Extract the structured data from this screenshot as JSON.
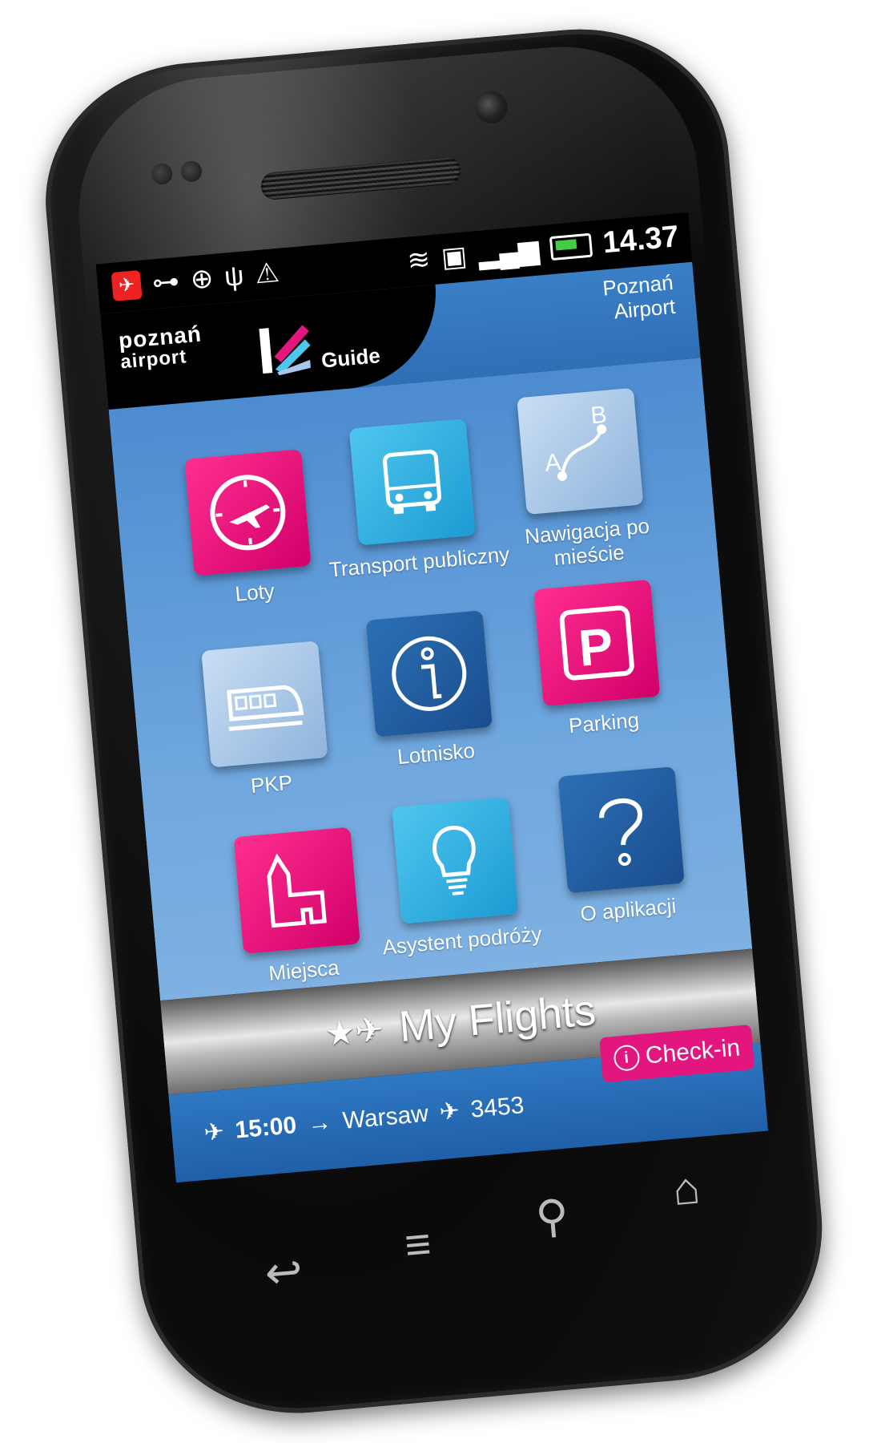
{
  "status_bar": {
    "time": "14.37",
    "left_icons": [
      "airport-app-icon",
      "key-icon",
      "download-icon",
      "usb-icon",
      "warning-icon"
    ],
    "right_icons": [
      "wifi-icon",
      "sync-icon",
      "signal-icon",
      "battery-icon"
    ]
  },
  "header": {
    "logo_line1": "poznań",
    "logo_line2": "airport",
    "logo_guide": "Guide",
    "link_line1": "Poznań",
    "link_line2": "Airport"
  },
  "tiles": [
    {
      "label": "Loty",
      "icon": "clock-plane-icon",
      "color": "#e3157e"
    },
    {
      "label": "Transport publiczny",
      "icon": "bus-icon",
      "color": "#2faee3"
    },
    {
      "label": "Nawigacja po mieście",
      "icon": "route-a-b-icon",
      "color": "#a9c7e8"
    },
    {
      "label": "PKP",
      "icon": "train-icon",
      "color": "#a9c7e8"
    },
    {
      "label": "Lotnisko",
      "icon": "info-icon",
      "color": "#245f9f"
    },
    {
      "label": "Parking",
      "icon": "parking-icon",
      "color": "#e3157e"
    },
    {
      "label": "Miejsca",
      "icon": "church-icon",
      "color": "#e3157e"
    },
    {
      "label": "Asystent podróży",
      "icon": "lightbulb-icon",
      "color": "#2faee3"
    },
    {
      "label": "O aplikacji",
      "icon": "question-icon",
      "color": "#245f9f"
    }
  ],
  "my_flights": {
    "label": "My Flights",
    "icon": "star-plane-icon"
  },
  "flight_info": {
    "time": "15:00",
    "arrow": "→",
    "destination": "Warsaw",
    "flight_number": "3453",
    "checkin_label": "Check-in"
  },
  "hardware_buttons": [
    "back-icon",
    "menu-icon",
    "search-icon",
    "home-icon"
  ]
}
